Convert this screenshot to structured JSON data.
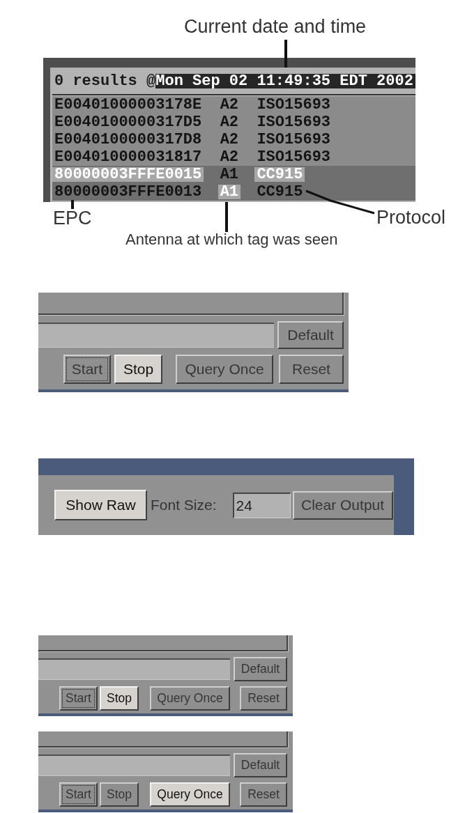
{
  "panels": [
    {
      "kind": "output",
      "caption": "Current date and time",
      "output": {
        "status": "0 results @",
        "timestamp": "Mon Sep 02 11:49:35 EDT 2002",
        "rows": [
          {
            "shaded": false,
            "cells": [
              {
                "text": "E00401000003178E",
                "highlighted": false
              },
              {
                "text": "A2",
                "highlighted": false
              },
              {
                "text": "ISO15693",
                "highlighted": false
              }
            ]
          },
          {
            "shaded": false,
            "cells": [
              {
                "text": "E0040100000317D5",
                "highlighted": false
              },
              {
                "text": "A2",
                "highlighted": false
              },
              {
                "text": "ISO15693",
                "highlighted": false
              }
            ]
          },
          {
            "shaded": false,
            "cells": [
              {
                "text": "E0040100000317D8",
                "highlighted": false
              },
              {
                "text": "A2",
                "highlighted": false
              },
              {
                "text": "ISO15693",
                "highlighted": false
              }
            ]
          },
          {
            "shaded": false,
            "cells": [
              {
                "text": "E004010000031817",
                "highlighted": false
              },
              {
                "text": "A2",
                "highlighted": false
              },
              {
                "text": "ISO15693",
                "highlighted": false
              }
            ]
          },
          {
            "shaded": true,
            "cells": [
              {
                "text": "80000003FFFE0015",
                "highlighted": true
              },
              {
                "text": "A1",
                "highlighted": false
              },
              {
                "text": "CC915",
                "highlighted": true
              }
            ]
          },
          {
            "shaded": true,
            "cells": [
              {
                "text": "80000003FFFE0013",
                "highlighted": false
              },
              {
                "text": "A1",
                "highlighted": true
              },
              {
                "text": "CC915",
                "highlighted": false
              }
            ]
          }
        ]
      },
      "callouts": [
        {
          "text": "EPC"
        },
        {
          "text": "Protocol"
        },
        {
          "text": "Antenna at which tag was seen"
        }
      ]
    },
    {
      "kind": "controls",
      "default_button": "Default",
      "buttons": [
        {
          "label": "Start",
          "focused": true,
          "selected": false
        },
        {
          "label": "Stop",
          "focused": false,
          "selected": true
        },
        {
          "label": "Query Once",
          "focused": false,
          "selected": false
        },
        {
          "label": "Reset",
          "focused": false,
          "selected": false
        }
      ]
    },
    {
      "kind": "display",
      "show_raw_button": {
        "label": "Show Raw",
        "selected": true
      },
      "font_size_label": "Font Size:",
      "font_size_field": {
        "value": "24"
      },
      "clear_button": {
        "label": "Clear Output",
        "selected": false
      }
    },
    {
      "kind": "controls",
      "default_button": "Default",
      "buttons": [
        {
          "label": "Start",
          "focused": true,
          "selected": false
        },
        {
          "label": "Stop",
          "focused": false,
          "selected": true
        },
        {
          "label": "Query Once",
          "focused": false,
          "selected": false
        },
        {
          "label": "Reset",
          "focused": false,
          "selected": false
        }
      ]
    },
    {
      "kind": "controls",
      "default_button": "Default",
      "buttons": [
        {
          "label": "Start",
          "focused": true,
          "selected": false
        },
        {
          "label": "Stop",
          "focused": false,
          "selected": false
        },
        {
          "label": "Query Once",
          "focused": false,
          "selected": true
        },
        {
          "label": "Reset",
          "focused": false,
          "selected": false
        }
      ]
    }
  ]
}
